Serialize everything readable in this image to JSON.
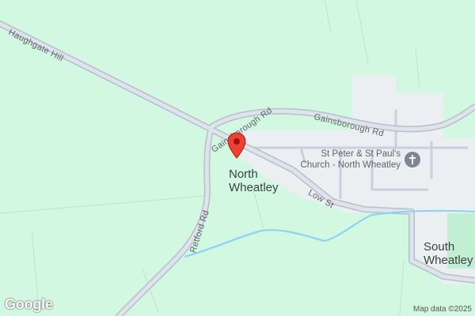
{
  "map": {
    "colors": {
      "land": "#d3f8e2",
      "urban": "#eceff1",
      "road": "#c7d0dc",
      "road_fill": "#dfe3ea",
      "water": "#8fd3f4",
      "pin": "#ea4335",
      "park": "#c2efd3"
    },
    "labels": {
      "haughgate_hill": "Haughgate Hill",
      "gainsborough_rd_1": "Gainsborough Rd",
      "gainsborough_rd_2": "Gainsborough Rd",
      "retford_rd": "Retford Rd",
      "low_st": "Low St"
    },
    "places": {
      "north_wheatley_line1": "North",
      "north_wheatley_line2": "Wheatley",
      "south_wheatley_line1": "South",
      "south_wheatley_line2": "Wheatley"
    },
    "poi": {
      "church_line1": "St Peter & St Paul's",
      "church_line2": "Church - North Wheatley",
      "church_icon": "church-cross-icon"
    },
    "marker": {
      "icon": "location-pin-icon"
    },
    "attribution": "Map data ©2025",
    "logo": "Google"
  }
}
